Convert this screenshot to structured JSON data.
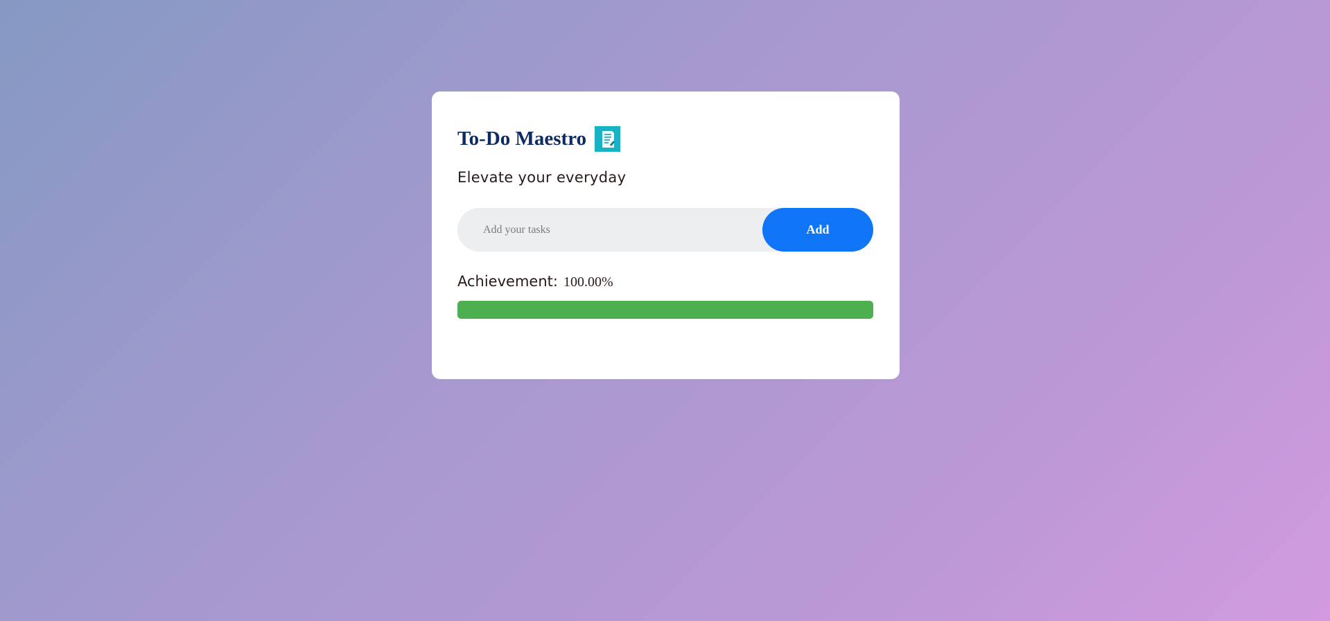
{
  "app": {
    "title": "To-Do Maestro",
    "title_icon": "notepad-icon",
    "subtitle": "Elevate your everyday"
  },
  "task_input": {
    "placeholder": "Add your tasks",
    "value": ""
  },
  "add_button": {
    "label": "Add"
  },
  "achievement": {
    "label": "Achievement:",
    "value_text": "100.00%",
    "progress_fraction": 1.0
  },
  "colors": {
    "accent": "#1175f7",
    "title": "#0f2b63",
    "icon_bg": "#19b2c4",
    "progress": "#4caf50"
  }
}
